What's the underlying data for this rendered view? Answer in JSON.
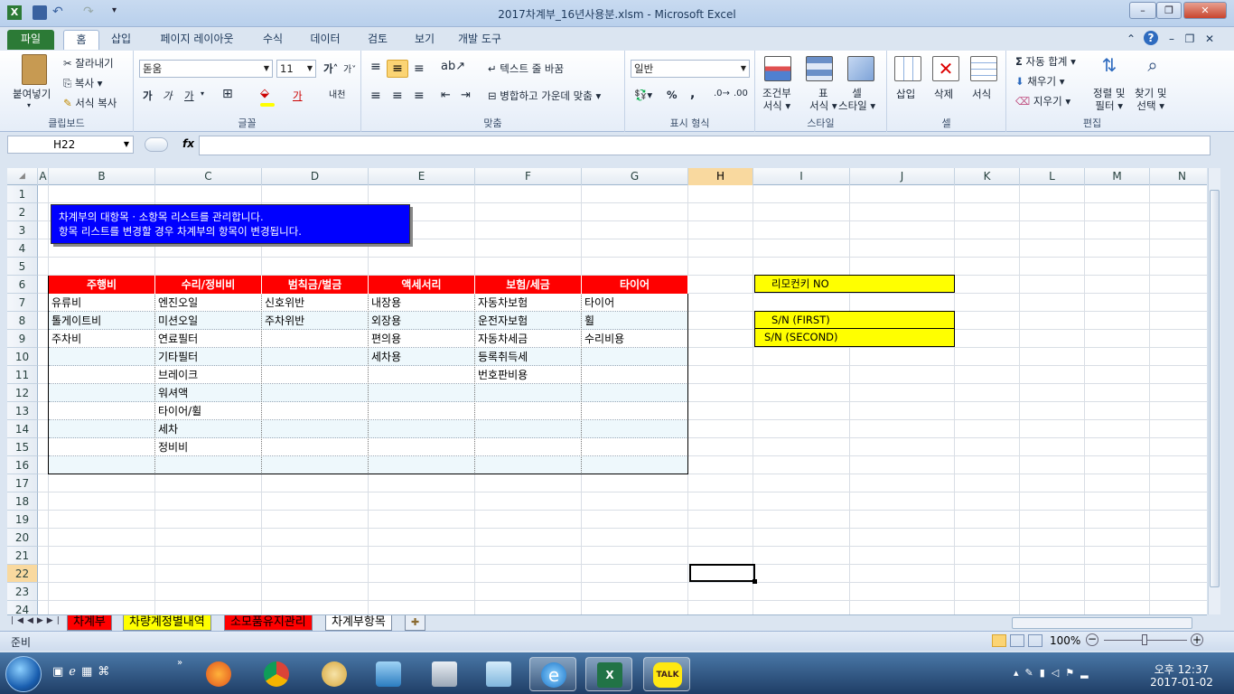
{
  "window": {
    "title": "2017차계부_16년사용분.xlsm  -  Microsoft Excel"
  },
  "menu_tabs": [
    "파일",
    "홈",
    "삽입",
    "페이지 레이아웃",
    "수식",
    "데이터",
    "검토",
    "보기",
    "개발 도구"
  ],
  "ribbon": {
    "clipboard": {
      "label": "클립보드",
      "paste": "붙여넣기",
      "cut": "잘라내기",
      "copy": "복사",
      "format_painter": "서식 복사"
    },
    "font": {
      "label": "글꼴",
      "font_name": "돋움",
      "font_size": "11",
      "bold": "가",
      "italic": "가",
      "underline": "가"
    },
    "align": {
      "label": "맞춤",
      "wrap": "텍스트 줄 바꿈",
      "merge": "병합하고 가운데 맞춤"
    },
    "number": {
      "label": "표시 형식",
      "format": "일반",
      "percent": "%",
      "comma": ","
    },
    "styles": {
      "label": "스타일",
      "cond_line1": "조건부",
      "cond_line2": "서식",
      "table_line1": "표",
      "table_line2": "서식",
      "cell_line1": "셀",
      "cell_line2": "스타일"
    },
    "cells": {
      "label": "셀",
      "insert": "삽입",
      "delete": "삭제",
      "format": "서식"
    },
    "editing": {
      "label": "편집",
      "autosum": "자동 합계",
      "fill": "채우기",
      "clear": "지우기",
      "sort_line1": "정렬 및",
      "sort_line2": "필터",
      "find_line1": "찾기 및",
      "find_line2": "선택"
    }
  },
  "formula_bar": {
    "name_box": "H22",
    "fx": "fx",
    "formula": ""
  },
  "columns": [
    "A",
    "B",
    "C",
    "D",
    "E",
    "F",
    "G",
    "H",
    "I",
    "J",
    "K",
    "L",
    "M",
    "N"
  ],
  "rows": [
    "1",
    "2",
    "3",
    "4",
    "5",
    "6",
    "7",
    "8",
    "9",
    "10",
    "11",
    "12",
    "13",
    "14",
    "15",
    "16",
    "17",
    "18",
    "19",
    "20",
    "21",
    "22",
    "23",
    "24"
  ],
  "notice": {
    "line1": "차계부의 대항목 · 소항목 리스트를 관리합니다.",
    "line2": "항목 리스트를 변경할 경우 차계부의 항목이 변경됩니다."
  },
  "table": {
    "headers": [
      "주행비",
      "수리/정비비",
      "범칙금/벌금",
      "액세서리",
      "보험/세금",
      "타이어"
    ],
    "columns": [
      [
        "유류비",
        "톨게이트비",
        "주차비"
      ],
      [
        "엔진오일",
        "미션오일",
        "연료필터",
        "기타필터",
        "브레이크",
        "워셔액",
        "타이어/휠",
        "세차",
        "정비비"
      ],
      [
        "신호위반",
        "주차위반"
      ],
      [
        "내장용",
        "외장용",
        "편의용",
        "세차용"
      ],
      [
        "자동차보험",
        "운전자보험",
        "자동차세금",
        "등록취득세",
        "번호판비용"
      ],
      [
        "타이어",
        "휠",
        "수리비용"
      ]
    ]
  },
  "side_boxes": [
    "리모컨키 NO",
    "S/N (FIRST)",
    "S/N (SECOND)"
  ],
  "sheet_tabs": [
    "차계부",
    "차량계정별내역",
    "소모품유지관리",
    "차계부항목"
  ],
  "status": {
    "ready": "준비",
    "zoom": "100%"
  },
  "taskbar": {
    "time": "오후 12:37",
    "date": "2017-01-02",
    "talk": "TALK"
  },
  "colors": {
    "header_red": "#ff0000",
    "notice_blue": "#0000ff",
    "box_yellow": "#ffff00",
    "file_tab": "#2c7a36",
    "selection": "#f9d99f"
  }
}
